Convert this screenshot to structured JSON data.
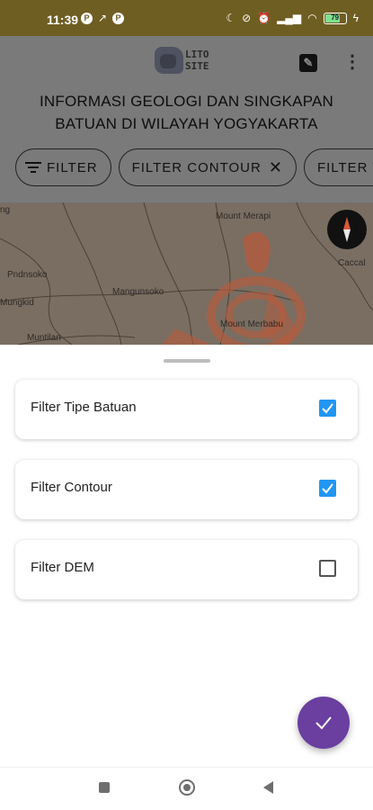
{
  "status_bar": {
    "time": "11:39",
    "left_icons": [
      "P",
      "↗",
      "P"
    ],
    "right_icons": [
      "moon-icon",
      "mute-icon",
      "alarm-icon",
      "signal-icon",
      "wifi-icon"
    ],
    "battery": "79",
    "battery_level": 0.79,
    "battery_color": "#7fe08b"
  },
  "header": {
    "logo_text": "LITO\nSITE",
    "title": "INFORMASI GEOLOGI DAN SINGKAPAN BATUAN DI WILAYAH YOGYAKARTA"
  },
  "chips": [
    {
      "label": "FILTER",
      "icon": "filter-icon"
    },
    {
      "label": "FILTER CONTOUR",
      "icon": "close-icon"
    },
    {
      "label": "FILTER T"
    }
  ],
  "map": {
    "labels": [
      "ng",
      "Mount Merapi",
      "Pndnsoko",
      "Mungkid",
      "Mangunsoko",
      "Caccal",
      "Mount Merbabu",
      "Muntilan"
    ]
  },
  "sheet": {
    "items": [
      {
        "label": "Filter Tipe Batuan",
        "checked": true
      },
      {
        "label": "Filter Contour",
        "checked": true
      },
      {
        "label": "Filter DEM",
        "checked": false
      }
    ]
  },
  "fab": {
    "icon": "check-icon"
  },
  "nav": {
    "icons": [
      "recent-apps-icon",
      "home-icon",
      "back-icon"
    ]
  },
  "colors": {
    "status_bar": "#6f5e22",
    "accent_checkbox": "#2196f3",
    "fab": "#6a3fa0",
    "scrim": "#7a7a7a"
  }
}
